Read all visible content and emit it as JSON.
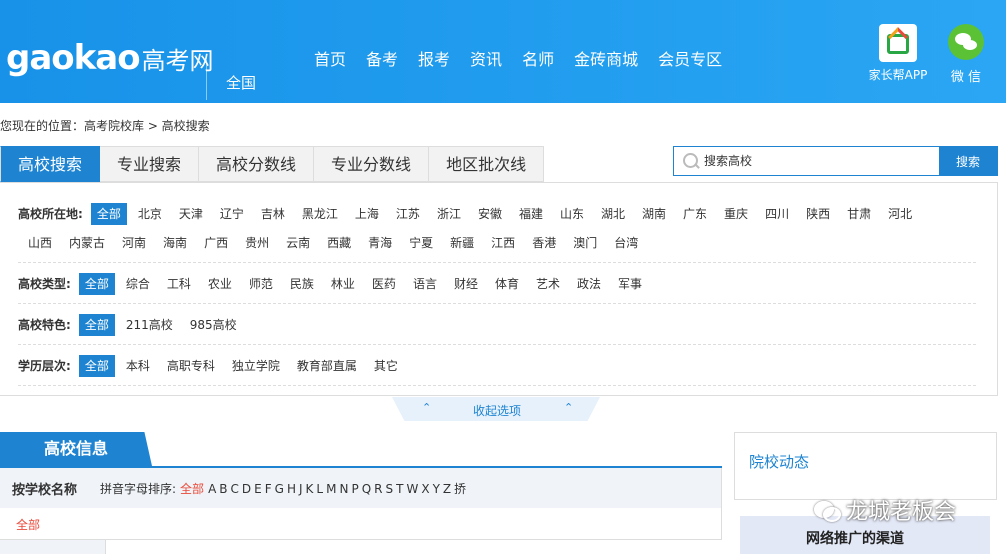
{
  "header": {
    "logo_en": "gaokao",
    "logo_cn": "高考网",
    "region": "全国",
    "nav": [
      "首页",
      "备考",
      "报考",
      "资讯",
      "名师",
      "金砖商城",
      "会员专区"
    ],
    "app_label": "家长帮APP",
    "wechat_label": "微 信"
  },
  "breadcrumb": "您现在的位置：高考院校库 > 高校搜索",
  "tabs": [
    "高校搜索",
    "专业搜索",
    "高校分数线",
    "专业分数线",
    "地区批次线"
  ],
  "search": {
    "placeholder": "搜索高校",
    "button": "搜索"
  },
  "filters": {
    "location": {
      "label": "高校所在地:",
      "items1": [
        "全部",
        "北京",
        "天津",
        "辽宁",
        "吉林",
        "黑龙江",
        "上海",
        "江苏",
        "浙江",
        "安徽",
        "福建",
        "山东",
        "湖北",
        "湖南",
        "广东",
        "重庆",
        "四川",
        "陕西",
        "甘肃",
        "河北"
      ],
      "items2": [
        "山西",
        "内蒙古",
        "河南",
        "海南",
        "广西",
        "贵州",
        "云南",
        "西藏",
        "青海",
        "宁夏",
        "新疆",
        "江西",
        "香港",
        "澳门",
        "台湾"
      ]
    },
    "type": {
      "label": "高校类型:",
      "items": [
        "全部",
        "综合",
        "工科",
        "农业",
        "师范",
        "民族",
        "林业",
        "医药",
        "语言",
        "财经",
        "体育",
        "艺术",
        "政法",
        "军事"
      ]
    },
    "feature": {
      "label": "高校特色:",
      "items": [
        "全部",
        "211高校",
        "985高校"
      ]
    },
    "level": {
      "label": "学历层次:",
      "items": [
        "全部",
        "本科",
        "高职专科",
        "独立学院",
        "教育部直属",
        "其它"
      ]
    }
  },
  "collapse_label": "收起选项",
  "info": {
    "tab_label": "高校信息",
    "by_name": "按学校名称",
    "pinyin_label": "拼音字母排序:",
    "pinyin_all": "全部",
    "letters": [
      "A",
      "B",
      "C",
      "D",
      "E",
      "F",
      "G",
      "H",
      "J",
      "K",
      "L",
      "M",
      "N",
      "P",
      "Q",
      "R",
      "S",
      "T",
      "W",
      "X",
      "Y",
      "Z",
      "挢"
    ],
    "all_link": "全部"
  },
  "side": {
    "news_title": "院校动态",
    "ad_text": "网络推广的渠道",
    "watermark": "龙城老板会"
  },
  "colors": {
    "brand": "#1e84d2",
    "header": "#1792e8",
    "highlight": "#e94a3a"
  }
}
